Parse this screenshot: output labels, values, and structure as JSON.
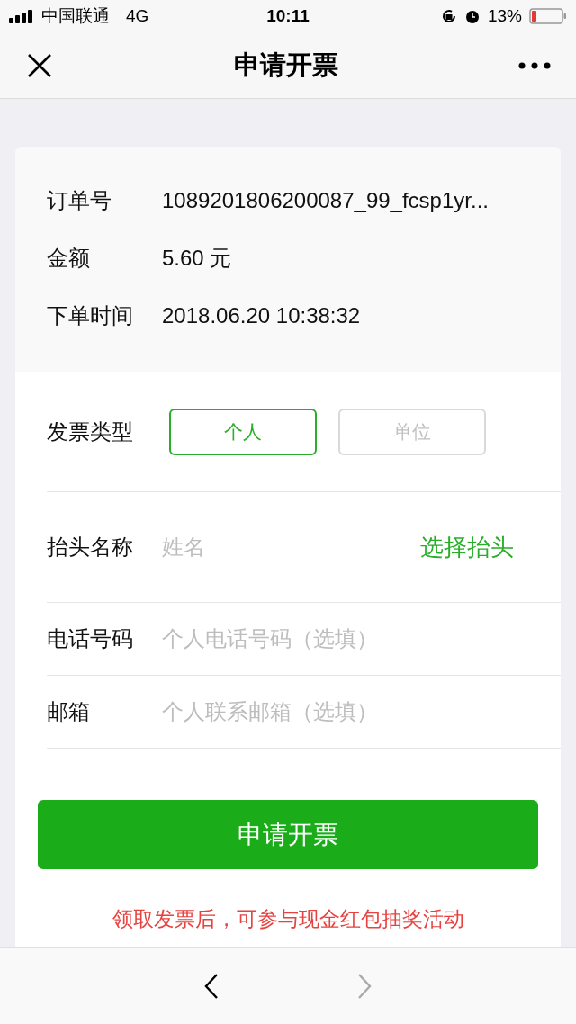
{
  "status_bar": {
    "carrier": "中国联通",
    "network": "4G",
    "time": "10:11",
    "battery": "13%"
  },
  "nav": {
    "title": "申请开票"
  },
  "order_info": [
    {
      "label": "订单号",
      "value": "1089201806200087_99_fcsp1yr..."
    },
    {
      "label": "金额",
      "value": "5.60 元"
    },
    {
      "label": "下单时间",
      "value": "2018.06.20 10:38:32"
    }
  ],
  "invoice_type": {
    "label": "发票类型",
    "options": [
      {
        "label": "个人",
        "selected": true
      },
      {
        "label": "单位",
        "selected": false
      }
    ]
  },
  "fields": [
    {
      "label": "抬头名称",
      "placeholder": "姓名",
      "action": "选择抬头"
    },
    {
      "label": "电话号码",
      "placeholder": "个人电话号码（选填）"
    },
    {
      "label": "邮箱",
      "placeholder": "个人联系邮箱（选填）"
    }
  ],
  "submit": "申请开票",
  "notice": "领取发票后，可参与现金红包抽奖活动",
  "bottom_nav": {
    "back_disabled": false,
    "forward_disabled": true
  }
}
